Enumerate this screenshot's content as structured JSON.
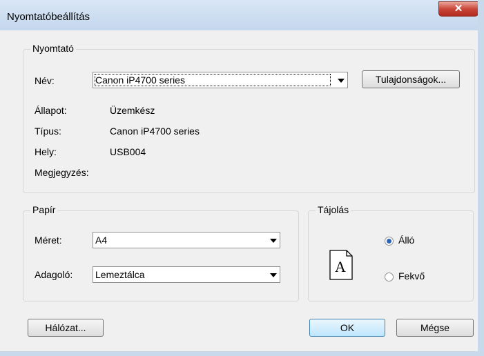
{
  "window": {
    "title": "Nyomtatóbeállítás",
    "close_glyph": "✕"
  },
  "printer_group": {
    "legend": "Nyomtató",
    "name_label": "Név:",
    "name_value": "Canon iP4700 series",
    "properties_button": "Tulajdonságok...",
    "status_label": "Állapot:",
    "status_value": "Üzemkész",
    "type_label": "Típus:",
    "type_value": "Canon iP4700 series",
    "location_label": "Hely:",
    "location_value": "USB004",
    "comment_label": "Megjegyzés:",
    "comment_value": ""
  },
  "paper_group": {
    "legend": "Papír",
    "size_label": "Méret:",
    "size_value": "A4",
    "source_label": "Adagoló:",
    "source_value": "Lemeztálca"
  },
  "orientation_group": {
    "legend": "Tájolás",
    "icon_letter": "A",
    "portrait_label": "Álló",
    "portrait_checked": true,
    "landscape_label": "Fekvő",
    "landscape_checked": false
  },
  "footer": {
    "network_button": "Hálózat...",
    "ok_button": "OK",
    "cancel_button": "Mégse"
  },
  "colors": {
    "title_bar": "#c4d7ee",
    "close_button": "#c9463a",
    "dialog_bg": "#f0f0f0",
    "radio_dot": "#2d66b6"
  }
}
